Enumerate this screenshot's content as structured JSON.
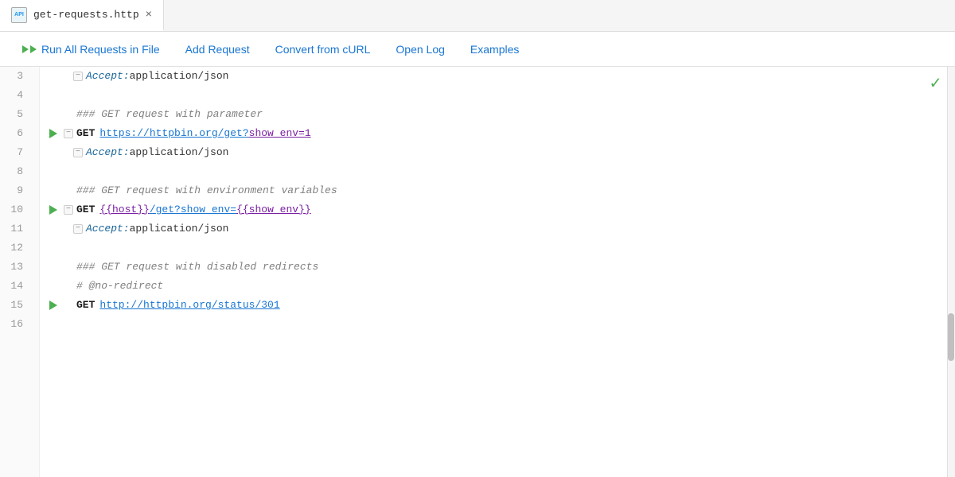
{
  "tab": {
    "icon_label": "API",
    "filename": "get-requests.http",
    "close_label": "×"
  },
  "toolbar": {
    "run_all_label": "Run All Requests in File",
    "add_request_label": "Add Request",
    "convert_curl_label": "Convert from cURL",
    "open_log_label": "Open Log",
    "examples_label": "Examples"
  },
  "lines": [
    {
      "num": "3",
      "type": "header",
      "content": "Accept: application/json"
    },
    {
      "num": "4",
      "type": "empty",
      "content": ""
    },
    {
      "num": "5",
      "type": "comment",
      "content": "### GET request with parameter"
    },
    {
      "num": "6",
      "type": "request",
      "method": "GET",
      "url_base": "https://httpbin.org/get?",
      "url_param": "show_env=1",
      "url_param_end": ""
    },
    {
      "num": "7",
      "type": "header",
      "content": "Accept: application/json"
    },
    {
      "num": "8",
      "type": "empty",
      "content": ""
    },
    {
      "num": "9",
      "type": "comment",
      "content": "### GET request with environment variables"
    },
    {
      "num": "10",
      "type": "request_var",
      "method": "GET",
      "url_start": "",
      "url_var1": "{{host}}",
      "url_mid": "/get?",
      "url_param": "show_env=",
      "url_var2": "{{show_env}}",
      "url_end": ""
    },
    {
      "num": "11",
      "type": "header",
      "content": "Accept: application/json"
    },
    {
      "num": "12",
      "type": "empty",
      "content": ""
    },
    {
      "num": "13",
      "type": "comment",
      "content": "### GET request with disabled redirects"
    },
    {
      "num": "14",
      "type": "directive",
      "content": "# @no-redirect"
    },
    {
      "num": "15",
      "type": "request_simple",
      "method": "GET",
      "url": "http://httpbin.org/status/301"
    },
    {
      "num": "16",
      "type": "empty",
      "content": ""
    }
  ],
  "checkmark": "✓"
}
